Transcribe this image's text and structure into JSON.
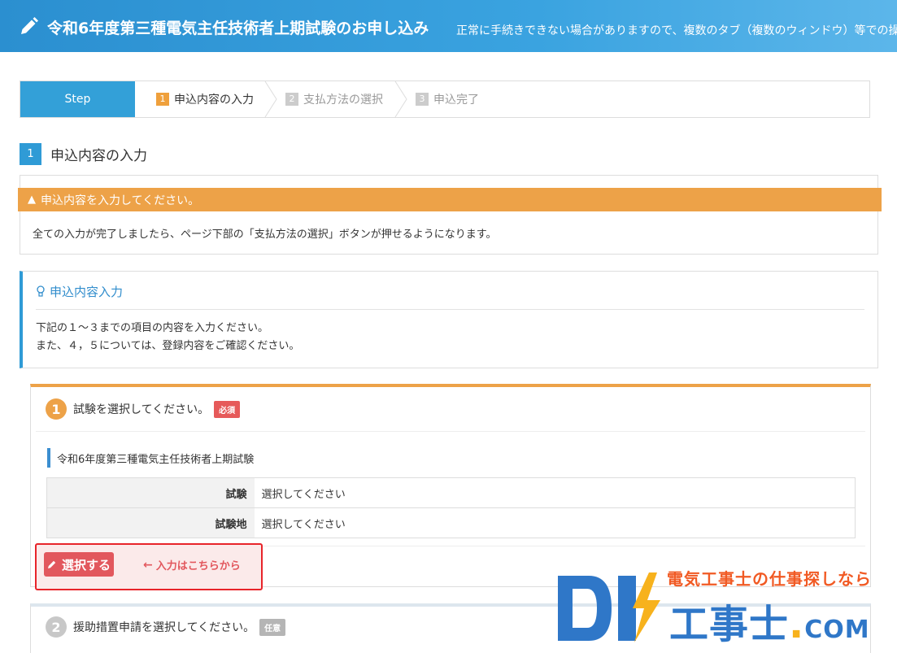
{
  "header": {
    "title": "令和6年度第三種電気主任技術者上期試験のお申し込み",
    "notice": "正常に手続きできない場合がありますので、複数のタブ（複数のウィンドウ）等での操"
  },
  "steps": {
    "label": "Step",
    "items": [
      {
        "num": "1",
        "label": "申込内容の入力"
      },
      {
        "num": "2",
        "label": "支払方法の選択"
      },
      {
        "num": "3",
        "label": "申込完了"
      }
    ]
  },
  "section": {
    "num": "1",
    "title": "申込内容の入力"
  },
  "warning": {
    "title": "申込内容を入力してください。",
    "text": "全ての入力が完了しましたら、ページ下部の「支払方法の選択」ボタンが押せるようになります。"
  },
  "info": {
    "title": "申込内容入力",
    "line1": "下記の１～３までの項目の内容を入力ください。",
    "line2": "また、４，５については、登録内容をご確認ください。"
  },
  "q1": {
    "num": "1",
    "text": "試験を選択してください。",
    "tag": "必須",
    "exam_title": "令和6年度第三種電気主任技術者上期試験",
    "rows": [
      {
        "label": "試験",
        "value": "選択してください"
      },
      {
        "label": "試験地",
        "value": "選択してください"
      }
    ],
    "button": "選択する",
    "hint": "入力はこちらから"
  },
  "q2": {
    "num": "2",
    "text": "援助措置申請を選択してください。",
    "tag": "任意"
  },
  "watermark": {
    "tagline": "電気工事士の仕事探しなら",
    "brand": "工事士",
    "dot": ".",
    "com": "COM"
  },
  "colors": {
    "header": "#2b8fd0",
    "accent_blue": "#2f9bd6",
    "warning": "#eda248",
    "required": "#e65a5a",
    "button": "#e2575d",
    "highlight_border": "#e8242a"
  }
}
